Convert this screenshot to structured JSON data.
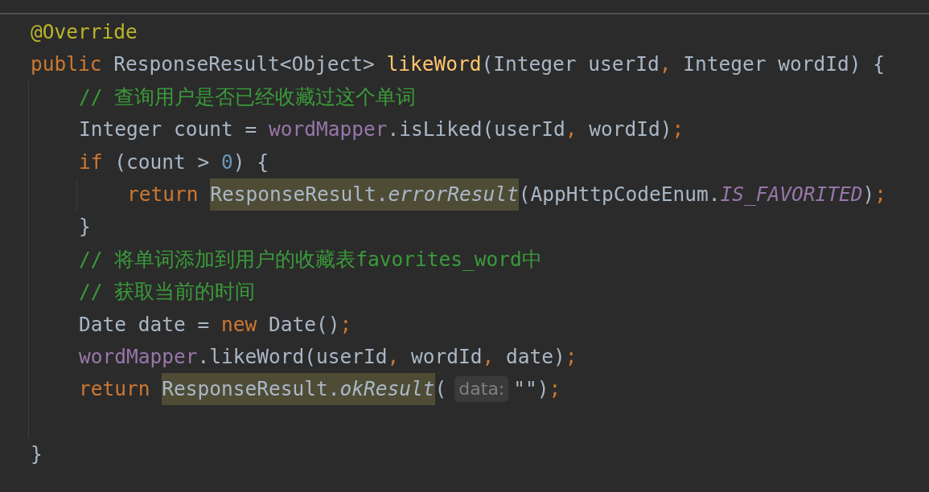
{
  "code": [
    {
      "tokens": [
        {
          "text": "@Override",
          "kind": "annotation"
        }
      ]
    },
    {
      "tokens": [
        {
          "text": "public",
          "kind": "keyword"
        },
        {
          "text": " ResponseResult<Object> ",
          "kind": "plain"
        },
        {
          "text": "likeWord",
          "kind": "method"
        },
        {
          "text": "(Integer userId",
          "kind": "plain"
        },
        {
          "text": ",",
          "kind": "punct"
        },
        {
          "text": " Integer wordId) {",
          "kind": "plain"
        }
      ]
    },
    {
      "trailing_blank": true,
      "children": [
        {
          "tokens": [
            {
              "text": "// 查询用户是否已经收藏过这个单词",
              "kind": "comment"
            }
          ]
        },
        {
          "tokens": [
            {
              "text": "Integer count = ",
              "kind": "plain"
            },
            {
              "text": "wordMapper",
              "kind": "field"
            },
            {
              "text": ".isLiked(userId",
              "kind": "plain"
            },
            {
              "text": ",",
              "kind": "punct"
            },
            {
              "text": " wordId)",
              "kind": "plain"
            },
            {
              "text": ";",
              "kind": "punct"
            }
          ]
        },
        {
          "tokens": [
            {
              "text": "if",
              "kind": "keyword"
            },
            {
              "text": " (count > ",
              "kind": "plain"
            },
            {
              "text": "0",
              "kind": "number"
            },
            {
              "text": ") {",
              "kind": "plain"
            }
          ]
        },
        {
          "trailing_blank": false,
          "children": [
            {
              "tokens": [
                {
                  "text": "return ",
                  "kind": "keyword"
                },
                {
                  "text": "ResponseResult.",
                  "kind": "plain",
                  "highlight": true
                },
                {
                  "text": "errorResult",
                  "kind": "static",
                  "highlight": true
                },
                {
                  "text": "(AppHttpCodeEnum.",
                  "kind": "plain"
                },
                {
                  "text": "IS_FAVORITED",
                  "kind": "constant"
                },
                {
                  "text": ")",
                  "kind": "plain"
                },
                {
                  "text": ";",
                  "kind": "punct"
                }
              ]
            }
          ]
        },
        {
          "tokens": [
            {
              "text": "}",
              "kind": "plain"
            }
          ]
        },
        {
          "tokens": [
            {
              "text": "// 将单词添加到用户的收藏表favorites_word中",
              "kind": "comment"
            }
          ]
        },
        {
          "tokens": [
            {
              "text": "// 获取当前的时间",
              "kind": "comment"
            }
          ]
        },
        {
          "tokens": [
            {
              "text": "Date date = ",
              "kind": "plain"
            },
            {
              "text": "new",
              "kind": "keyword"
            },
            {
              "text": " Date()",
              "kind": "plain"
            },
            {
              "text": ";",
              "kind": "punct"
            }
          ]
        },
        {
          "tokens": [
            {
              "text": "wordMapper",
              "kind": "field"
            },
            {
              "text": ".likeWord(userId",
              "kind": "plain"
            },
            {
              "text": ",",
              "kind": "punct"
            },
            {
              "text": " wordId",
              "kind": "plain"
            },
            {
              "text": ",",
              "kind": "punct"
            },
            {
              "text": " date)",
              "kind": "plain"
            },
            {
              "text": ";",
              "kind": "punct"
            }
          ]
        },
        {
          "tokens": [
            {
              "text": "return ",
              "kind": "keyword"
            },
            {
              "text": "ResponseResult.",
              "kind": "plain",
              "highlight": true
            },
            {
              "text": "okResult",
              "kind": "static",
              "highlight": true
            },
            {
              "text": "(",
              "kind": "plain"
            },
            {
              "text": "data:",
              "kind": "hint"
            },
            {
              "text": "\"\")",
              "kind": "plain"
            },
            {
              "text": ";",
              "kind": "punct"
            }
          ]
        }
      ]
    },
    {
      "tokens": [
        {
          "text": "}",
          "kind": "plain"
        }
      ]
    }
  ]
}
